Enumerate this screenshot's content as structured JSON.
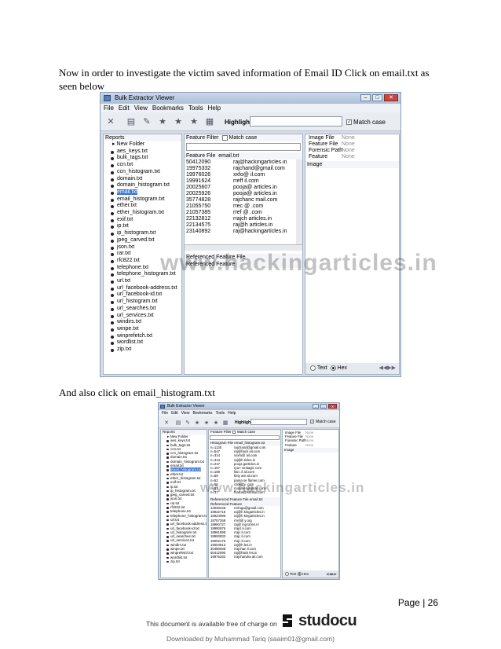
{
  "paragraph1": "Now in order to investigate the victim saved information of Email ID Click on email.txt as seen below",
  "paragraph2": "And also click on email_histogram.txt",
  "watermark": "www.hackingarticles.in",
  "app": {
    "title": "Bulk Extractor Viewer",
    "menu": [
      "File",
      "Edit",
      "View",
      "Bookmarks",
      "Tools",
      "Help"
    ],
    "highlight_label": "Highlight:",
    "match_case": "Match case",
    "reports_label": "Reports",
    "root_folder": "New Folder",
    "feature_filter_label": "Feature Filter",
    "image_meta": [
      {
        "k": "Image File",
        "v": "None"
      },
      {
        "k": "Feature File",
        "v": "None"
      },
      {
        "k": "Forensic Path",
        "v": "None"
      },
      {
        "k": "Feature",
        "v": "None"
      }
    ],
    "image_label": "Image",
    "text_label": "Text",
    "hex_label": "Hex",
    "referenced_feature_file_label": "Referenced Feature File",
    "referenced_feature_label": "Referenced Feature"
  },
  "screenshot1": {
    "files": [
      "aes_keys.txt",
      "bulk_tags.txt",
      "ccn.txt",
      "ccn_histogram.txt",
      "domain.txt",
      "domain_histogram.txt",
      "email.txt",
      "email_histogram.txt",
      "ether.txt",
      "ether_histogram.txt",
      "exif.txt",
      "ip.txt",
      "ip_histogram.txt",
      "jpeg_carved.txt",
      "json.txt",
      "rar.txt",
      "rfc822.txt",
      "telephone.txt",
      "telephone_histogram.txt",
      "url.txt",
      "url_facebook-address.txt",
      "url_facebook-id.txt",
      "url_histogram.txt",
      "url_searches.txt",
      "url_services.txt",
      "windirs.txt",
      "winpe.txt",
      "winprefetch.txt",
      "wordlist.txt",
      "zip.txt"
    ],
    "selected_index": 6,
    "feature_file_label": "Feature File",
    "feature_file_value": "email.txt",
    "rows": [
      {
        "offset": "50412090",
        "feature": "raj@hackingarticles.in"
      },
      {
        "offset": "19975332",
        "feature": "rajchand@gmail.com"
      },
      {
        "offset": "19976026",
        "feature": "xxfo@ il.com"
      },
      {
        "offset": "19991624",
        "feature": "rreff il.com"
      },
      {
        "offset": "20025607",
        "feature": "pooja@ articles.in"
      },
      {
        "offset": "20025926",
        "feature": "pooja@ articles.in"
      },
      {
        "offset": "35774828",
        "feature": "rajchanc mail.com"
      },
      {
        "offset": "21055750",
        "feature": "rrec @ .com"
      },
      {
        "offset": "21057385",
        "feature": "rref @ .com"
      },
      {
        "offset": "22132812",
        "feature": "rrajch articles.in"
      },
      {
        "offset": "22134575",
        "feature": "raj@h articles.in"
      },
      {
        "offset": "23140892",
        "feature": "raj@hackingarticles.in"
      }
    ]
  },
  "screenshot2": {
    "files": [
      "aes_keys.txt",
      "bulk_tags.txt",
      "ccn.txt",
      "ccn_histogram.txt",
      "domain.txt",
      "domain_histogram.txt",
      "email.txt",
      "email_histogram.txt",
      "ether.txt",
      "ether_histogram.txt",
      "exif.txt",
      "ip.txt",
      "ip_histogram.txt",
      "jpeg_carved.txt",
      "json.txt",
      "rar.txt",
      "rfc822.txt",
      "telephone.txt",
      "telephone_histogram.txt",
      "url.txt",
      "url_facebook-address.txt",
      "url_facebook-id.txt",
      "url_histogram.txt",
      "url_searches.txt",
      "url_services.txt",
      "windirs.txt",
      "winpe.txt",
      "winprefetch.txt",
      "wordlist.txt",
      "zip.txt"
    ],
    "selected_index": 7,
    "feature_file_label": "Histogram File",
    "feature_file_value": "email_histogram.txt",
    "rows": [
      {
        "offset": "n=1130",
        "feature": "rajchand@gmail.com"
      },
      {
        "offset": "n=547",
        "feature": "raj@hack ail.com"
      },
      {
        "offset": "n=314",
        "feature": "xxxfo@ ail.com"
      },
      {
        "offset": "n=313",
        "feature": "raj@h ticles.in"
      },
      {
        "offset": "n=217",
        "feature": "pooja garticles.in"
      },
      {
        "offset": "n=167",
        "feature": "rya-r vestagic.com"
      },
      {
        "offset": "n=159",
        "feature": "fian .il ail.com"
      },
      {
        "offset": "n=69",
        "feature": "fiety am ail.com"
      },
      {
        "offset": "n=62",
        "feature": "pama se flamer.com"
      },
      {
        "offset": "n=56",
        "feature": "cdo@hi .com"
      },
      {
        "offset": "n=51",
        "feature": "rnoamer@gmail.com"
      },
      {
        "offset": "n=37",
        "feature": "fsaica@hotmail.com"
      }
    ],
    "ref_file": "email.txt",
    "ref_rows": [
      {
        "offset": "13030248",
        "feature": "rrefoga@gmail.com"
      },
      {
        "offset": "16922715",
        "feature": "raj@h kingarticles.in"
      },
      {
        "offset": "16924095",
        "feature": "raj@h kingarticles.in"
      },
      {
        "offset": "18757268",
        "feature": "rrref@ y.org"
      },
      {
        "offset": "18950727",
        "feature": "raj@ ing ticles.in"
      },
      {
        "offset": "18950976",
        "feature": "rrajcl il.com"
      },
      {
        "offset": "18961898",
        "feature": "rrajc il.com"
      },
      {
        "offset": "18993933",
        "feature": "rrajc il.com"
      },
      {
        "offset": "19002176",
        "feature": "rrajc il.com"
      },
      {
        "offset": "19004813",
        "feature": "raj@h les.in"
      },
      {
        "offset": "30480938",
        "feature": "rrajchan il.com"
      },
      {
        "offset": "50412090",
        "feature": "raj@hack les.in"
      },
      {
        "offset": "19975332",
        "feature": "rrajchandra ail.com"
      }
    ]
  },
  "page_number": "Page | 26",
  "footer_available": "This document is available free of charge on",
  "footer_brand": "studocu",
  "footer_downloaded": "Downloaded by Muhammad Tariq (saaim01@gmail.com)"
}
